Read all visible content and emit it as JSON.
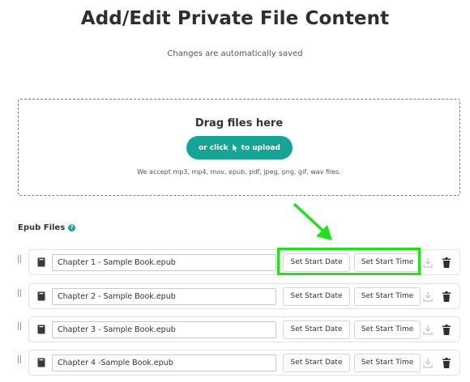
{
  "page": {
    "title": "Add/Edit Private File Content",
    "subtitle": "Changes are automatically saved"
  },
  "dropzone": {
    "title": "Drag files here",
    "upload_label_pre": "or click",
    "upload_label_post": "to upload",
    "note": "We accept mp3, mp4, mov, epub, pdf, jpeg, png, gif, wav files."
  },
  "section": {
    "title": "Epub Files",
    "help_icon": "?"
  },
  "files": [
    {
      "name": "Chapter 1 - Sample Book.epub",
      "date_label": "Set Start Date",
      "time_label": "Set Start Time"
    },
    {
      "name": "Chapter 2 - Sample Book.epub",
      "date_label": "Set Start Date",
      "time_label": "Set Start Time"
    },
    {
      "name": "Chapter 3 - Sample Book.epub",
      "date_label": "Set Start Date",
      "time_label": "Set Start Time"
    },
    {
      "name": "Chapter 4 -Sample Book.epub",
      "date_label": "Set Start Date",
      "time_label": "Set Start Time"
    }
  ],
  "colors": {
    "accent": "#17a396",
    "annotation": "#22e01b"
  }
}
